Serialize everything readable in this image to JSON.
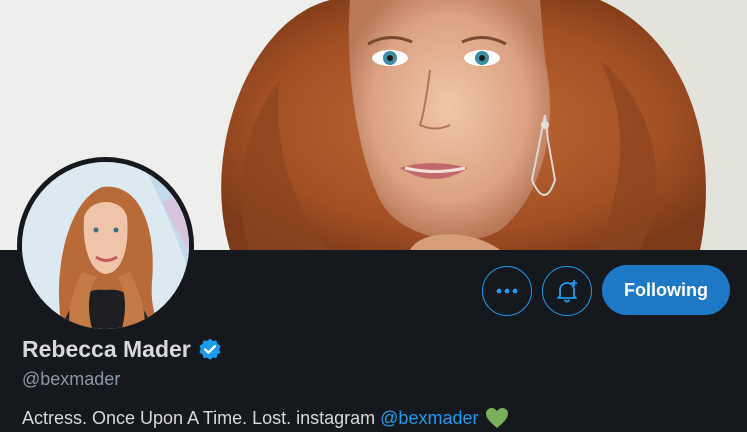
{
  "profile": {
    "display_name": "Rebecca Mader",
    "handle": "@bexmader",
    "bio_text": "Actress. Once Upon A Time. Lost. instagram",
    "bio_link": "@bexmader"
  },
  "actions": {
    "following_label": "Following"
  },
  "icons": {
    "more": "more-horizontal-icon",
    "notify": "bell-plus-icon",
    "verified": "verified-badge-icon",
    "heart": "green-heart-icon"
  },
  "colors": {
    "accent": "#1d9bf0",
    "following_bg": "#1d78c5",
    "background": "#15181c",
    "heart": "#78b159"
  }
}
